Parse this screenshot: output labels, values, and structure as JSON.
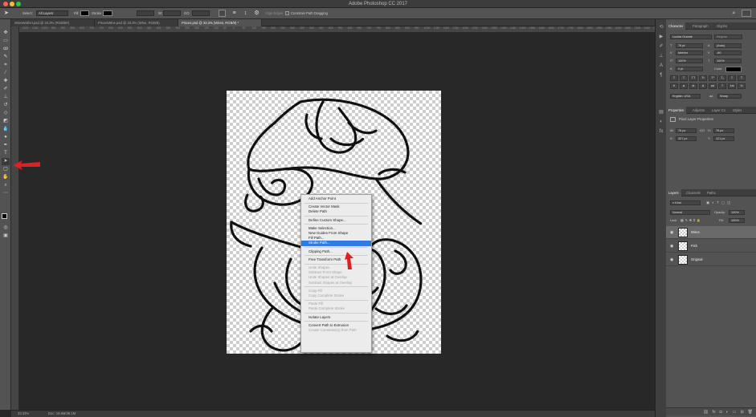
{
  "window": {
    "title": "Adobe Photoshop CC 2017"
  },
  "options_bar": {
    "select_label": "Select:",
    "select_value": "All Layers",
    "fill_label": "Fill:",
    "stroke_label": "Stroke:",
    "w_label": "W:",
    "h_label": "GO",
    "align_edges": "Align Edges",
    "constrain": "Constrain Path Dragging"
  },
  "tabs": [
    {
      "label": "WineWallArt.psd @ 33.3% (RGB/8#)"
    },
    {
      "label": "PiscesWine.psd @ 33.3% (Wine, RGB/8)"
    },
    {
      "label": "Pisces.psd @ 33.3% (Wires, RGB/8) *"
    }
  ],
  "ruler_marks": [
    "1100",
    "1050",
    "1000",
    "950",
    "900",
    "850",
    "800",
    "750",
    "700",
    "650",
    "600",
    "550",
    "500",
    "450",
    "400",
    "350",
    "300",
    "250",
    "200",
    "150",
    "100",
    "50",
    "0",
    "50",
    "100",
    "150",
    "200",
    "250",
    "300",
    "350",
    "400",
    "450",
    "500",
    "550",
    "600",
    "650",
    "700",
    "750",
    "800",
    "850",
    "900",
    "950",
    "1000",
    "1050",
    "1100",
    "1150",
    "1200",
    "1250",
    "1300",
    "1350",
    "1400",
    "1450",
    "1500",
    "1550",
    "1600",
    "1650",
    "1700",
    "1750",
    "1800",
    "1850",
    "1900",
    "1950",
    "2000",
    "2050",
    "2100",
    "2150",
    "2200"
  ],
  "context_menu": {
    "groups": [
      [
        {
          "label": "Add Anchor Point",
          "state": "normal"
        }
      ],
      [
        {
          "label": "Create Vector Mask",
          "state": "normal"
        },
        {
          "label": "Delete Path",
          "state": "normal"
        }
      ],
      [
        {
          "label": "Define Custom Shape...",
          "state": "normal"
        }
      ],
      [
        {
          "label": "Make Selection...",
          "state": "normal"
        },
        {
          "label": "New Guides From Shape",
          "state": "normal"
        },
        {
          "label": "Fill Path...",
          "state": "normal"
        },
        {
          "label": "Stroke Path...",
          "state": "highlight"
        }
      ],
      [
        {
          "label": "Clipping Path...",
          "state": "normal"
        }
      ],
      [
        {
          "label": "Free Transform Path",
          "state": "normal"
        }
      ],
      [
        {
          "label": "Unite Shapes",
          "state": "disabled"
        },
        {
          "label": "Subtract Front Shape",
          "state": "disabled"
        },
        {
          "label": "Unite Shapes at Overlap",
          "state": "disabled"
        },
        {
          "label": "Subtract Shapes at Overlap",
          "state": "disabled"
        }
      ],
      [
        {
          "label": "Copy Fill",
          "state": "disabled"
        },
        {
          "label": "Copy Complete Stroke",
          "state": "disabled"
        }
      ],
      [
        {
          "label": "Paste Fill",
          "state": "disabled"
        },
        {
          "label": "Paste Complete Stroke",
          "state": "disabled"
        }
      ],
      [
        {
          "label": "Isolate Layers",
          "state": "normal"
        }
      ],
      [
        {
          "label": "Convert Path to Extrusion",
          "state": "normal"
        },
        {
          "label": "Create Constraint(s) from Path",
          "state": "disabled"
        }
      ]
    ]
  },
  "character_panel": {
    "tabs": [
      "Character",
      "Paragraph",
      "Glyphs"
    ],
    "font_family": "Lucida Grande",
    "font_style": "Regular",
    "font_size": "76 pt",
    "leading": "(Auto)",
    "kerning": "Metrics",
    "tracking": "-60",
    "vertical_scale": "100%",
    "horizontal_scale": "100%",
    "baseline_shift": "0 pt",
    "color_label": "Color:",
    "style_buttons": [
      "T",
      "T",
      "TT",
      "Tr",
      "T¹",
      "T₁",
      "T",
      "T"
    ],
    "ot_buttons": [
      "fi",
      "ø",
      "st",
      "A",
      "ad",
      "T",
      "1st",
      "½"
    ],
    "language": "English: USA",
    "antialias_icon": "aa",
    "antialias": "Sharp"
  },
  "properties_panel": {
    "tabs": [
      "Properties",
      "Adjustm",
      "Layer Co",
      "Styles"
    ],
    "heading": "Pixel Layer Properties",
    "w_label": "W:",
    "w_value": "76 px",
    "h_label": "H:",
    "h_value": "76 px",
    "x_label": "X:",
    "x_value": "327 px",
    "y_label": "Y:",
    "y_value": "121 px",
    "link_icon": "GO"
  },
  "layers_panel": {
    "tabs": [
      "Layers",
      "Channels",
      "Paths"
    ],
    "filter_kind": "Kind",
    "blend_mode": "Normal",
    "opacity_label": "Opacity:",
    "opacity": "100%",
    "lock_label": "Lock:",
    "fill_label": "Fill:",
    "fill": "100%",
    "layers": [
      {
        "name": "Wires",
        "selected": true
      },
      {
        "name": "Fish",
        "selected": false
      },
      {
        "name": "Original",
        "selected": false
      }
    ],
    "footer_icons": [
      "link-icon",
      "fx-icon",
      "mask-icon",
      "adjustment-icon",
      "folder-icon",
      "new-layer-icon",
      "trash-icon"
    ]
  },
  "status": {
    "zoom": "33.33%",
    "doc": "Doc: 19.6M/39.1M"
  },
  "colors": {
    "accent": "#2f7ae5",
    "annotation": "#e02020",
    "canvas_bg": "#282828",
    "ui_panel": "#535353"
  }
}
